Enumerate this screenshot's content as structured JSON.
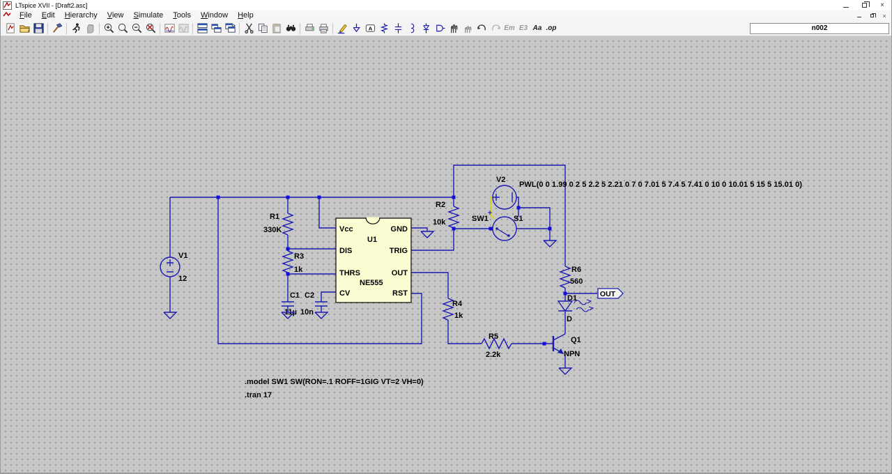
{
  "window": {
    "title": "LTspice XVII - [Draft2.asc]"
  },
  "menubar": {
    "items": [
      "File",
      "Edit",
      "Hierarchy",
      "View",
      "Simulate",
      "Tools",
      "Window",
      "Help"
    ]
  },
  "toolbar": {
    "net_indicator": "n002",
    "glyphs": {
      "label": "A",
      "mirror": "Em",
      "rotate": "E3",
      "text": "Aa",
      "spice": ".op"
    }
  },
  "schematic": {
    "colors": {
      "wire": "#1a1ab2",
      "highlight_wire": "#d6d600",
      "chip_fill": "#fcfcd2",
      "background": "#c7c7c7"
    },
    "sources": {
      "v1": {
        "name": "V1",
        "value": "12"
      },
      "v2": {
        "name": "V2"
      }
    },
    "resistors": {
      "r1": {
        "name": "R1",
        "value": "330K"
      },
      "r2": {
        "name": "R2",
        "value": "10k"
      },
      "r3": {
        "name": "R3",
        "value": "1k"
      },
      "r4": {
        "name": "R4",
        "value": "1k"
      },
      "r5": {
        "name": "R5",
        "value": "2.2k"
      },
      "r6": {
        "name": "R6",
        "value": "560"
      }
    },
    "capacitors": {
      "c1": {
        "name": "C1",
        "value": "11µ"
      },
      "c2": {
        "name": "C2",
        "value": "10n"
      }
    },
    "switch": {
      "model_label": "SW1",
      "name": "S1"
    },
    "diode": {
      "name": "D1",
      "model": "D"
    },
    "transistor": {
      "name": "Q1",
      "type": "NPN"
    },
    "ic": {
      "refdes": "U1",
      "part": "NE555",
      "pins_left": [
        "Vcc",
        "DIS",
        "THRS",
        "CV"
      ],
      "pins_right": [
        "GND",
        "TRIG",
        "OUT",
        "RST"
      ]
    },
    "pwl": "PWL(0 0 1.99 0 2 5 2.2 5 2.21 0 7 0 7.01 5 7.4 5 7.41 0 10 0 10.01 5 15 5 15.01 0)",
    "net_flag": "OUT",
    "directives": [
      ".model SW1 SW(RON=.1 ROFF=1GIG VT=2 VH=0)",
      ".tran 17"
    ]
  }
}
